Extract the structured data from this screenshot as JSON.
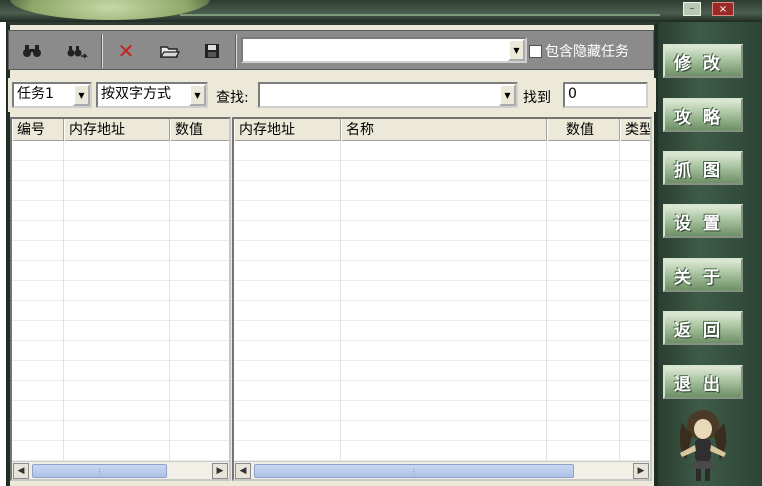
{
  "window": {
    "minimize": "–",
    "close": "×"
  },
  "toolbar": {
    "icons": [
      "binoculars-icon",
      "find-next-icon",
      "delete-icon",
      "open-folder-icon",
      "save-icon"
    ],
    "glyphs": {
      "binoculars": "⚲",
      "find_next": "⚲",
      "delete": "✕",
      "open": "▱",
      "save": "▪"
    },
    "search_value": "",
    "hidden_task_label": "包含隐藏任务",
    "hidden_task_checked": false
  },
  "search_row": {
    "task_select": "任务1",
    "mode_select": "按双字方式",
    "find_label": "查找",
    "find_value": "",
    "found_label": "找到",
    "found_value": "0"
  },
  "left_table": {
    "columns": [
      "编号",
      "内存地址",
      "数值"
    ],
    "rows": []
  },
  "right_table": {
    "columns": [
      "内存地址",
      "名称",
      "数值",
      "类型"
    ],
    "rows": []
  },
  "scroll_glyphs": {
    "left": "◀",
    "right": "▶",
    "thumb": "⋮"
  },
  "side_buttons": [
    "修改",
    "攻略",
    "抓图",
    "设置",
    "关于",
    "返回",
    "退出"
  ],
  "colors": {
    "skin_dark": "#2a3d31",
    "skin_button": "#a9c4a0",
    "panel": "#ece9d8",
    "close": "#9b2a26"
  }
}
